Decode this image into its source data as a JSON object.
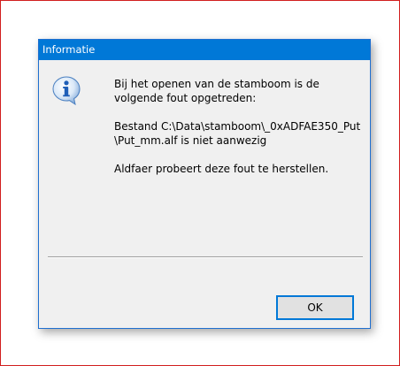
{
  "dialog": {
    "title": "Informatie",
    "icon": "info-icon",
    "message": {
      "para1_line1": "Bij het openen van de stamboom is de",
      "para1_line2": "volgende fout opgetreden:",
      "para2_line1": "Bestand C:\\Data\\stamboom\\_0xADFAE350_Put",
      "para2_line2": "\\Put_mm.alf is niet aanwezig",
      "para3_line1": "Aldfaer probeert deze fout te herstellen."
    },
    "ok_label": "OK"
  },
  "colors": {
    "titlebar": "#0078d7",
    "dialog_bg": "#f0f0f0",
    "button_border": "#0078d7",
    "outer_frame": "#d21f1f"
  }
}
